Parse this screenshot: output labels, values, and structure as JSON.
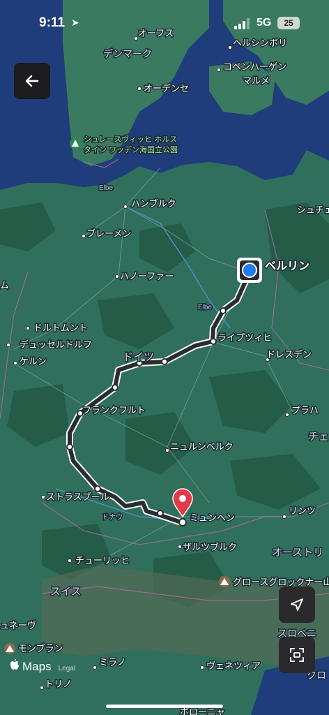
{
  "status_bar": {
    "time": "9:11",
    "network": "5G",
    "battery": "25"
  },
  "labels": {
    "aarhus": "オーフス",
    "denmark": "デンマーク",
    "helsingborg": "ヘルシンボリ",
    "copenhagen": "コペンハーゲン",
    "malmo": "マルメ",
    "odense": "オーデンセ",
    "park_line1": "シュレースヴィッヒ ホルス",
    "park_line2": "タイン ワッデン海国立公園",
    "elbe_north": "Elbe",
    "hamburg": "ハンブルク",
    "szczecin": "シュチェ",
    "bremen": "ブレーメン",
    "berlin": "ベルリン",
    "hanover": "ハノーファー",
    "amsterdam_edge": "ム",
    "elbe_mid": "Elbe",
    "dortmund": "ドルトムント",
    "leipzig": "ライプツィヒ",
    "dusseldorf": "デュッセルドルフ",
    "cologne": "ケルン",
    "germany": "ドイツ",
    "dresden": "ドレスデン",
    "frankfurt": "フランクフルト",
    "prague": "プラハ",
    "czech_edge": "チェ",
    "nuremberg": "ニュルンベルク",
    "strasbourg": "ストラスブール",
    "danube": "ドナウ",
    "munich": "ミュンヘン",
    "linz": "リンツ",
    "salzburg": "ザルツブルク",
    "austria": "オーストリ",
    "zurich": "チューリッヒ",
    "grossglockner": "グロースグロックナー山",
    "switzerland": "スイス",
    "geneva": "ュネーヴ",
    "slovenia_edge": "スロベニ",
    "mont_blanc": "モンブラン",
    "milan": "ミラノ",
    "venice": "ヴェネツィア",
    "turin": "トリノ",
    "croatia_edge": "クロ",
    "bologna_edge": "ボローニャ"
  },
  "attribution": {
    "brand": "Maps",
    "legal": "Legal"
  },
  "icons": {
    "back": "arrow-left-icon",
    "locate": "location-arrow-icon",
    "scan": "scan-icon"
  },
  "colors": {
    "land": "#2f6f5c",
    "forest": "#245c48",
    "sea": "#1f3d7a",
    "route": "#2a2d30",
    "destination_pin": "#e5394a",
    "current_location": "#1e7bf0"
  }
}
